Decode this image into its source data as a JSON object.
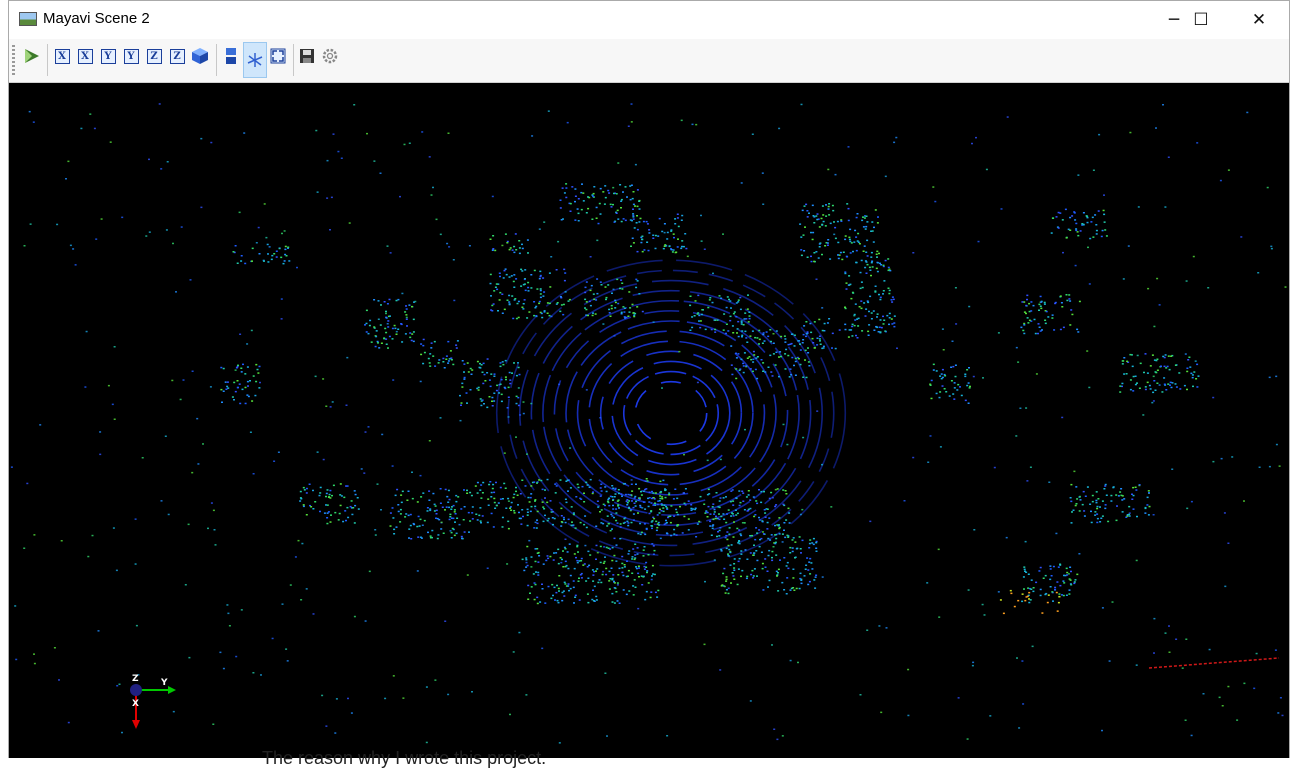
{
  "window": {
    "title": "Mayavi Scene 2",
    "controls": {
      "minimize": "─",
      "maximize": "☐",
      "close": "✕"
    }
  },
  "toolbar": {
    "buttons": [
      {
        "name": "mayavi-pipeline",
        "icon": "mayavi-logo-icon"
      },
      {
        "name": "view-x-plus",
        "label": "X"
      },
      {
        "name": "view-x-minus",
        "label": "X"
      },
      {
        "name": "view-y-plus",
        "label": "Y"
      },
      {
        "name": "view-y-minus",
        "label": "Y"
      },
      {
        "name": "view-z-plus",
        "label": "Z"
      },
      {
        "name": "view-z-minus",
        "label": "Z"
      },
      {
        "name": "isometric-view",
        "icon": "cube-icon"
      },
      {
        "name": "parallel-projection",
        "icon": "projection-icon"
      },
      {
        "name": "toggle-axes",
        "icon": "axes-icon",
        "active": true
      },
      {
        "name": "full-screen",
        "icon": "fullscreen-icon"
      },
      {
        "name": "save-scene",
        "icon": "save-icon"
      },
      {
        "name": "configure-scene",
        "icon": "gear-icon"
      }
    ]
  },
  "axes_indicator": {
    "z": "Z",
    "y": "Y",
    "x": "X"
  },
  "colors": {
    "background": "#000000",
    "ring": "#1f3fff",
    "axis_x": "#e00000",
    "axis_y": "#00c800",
    "axis_z": "#202080"
  },
  "background_text": "The reason why I wrote this project."
}
